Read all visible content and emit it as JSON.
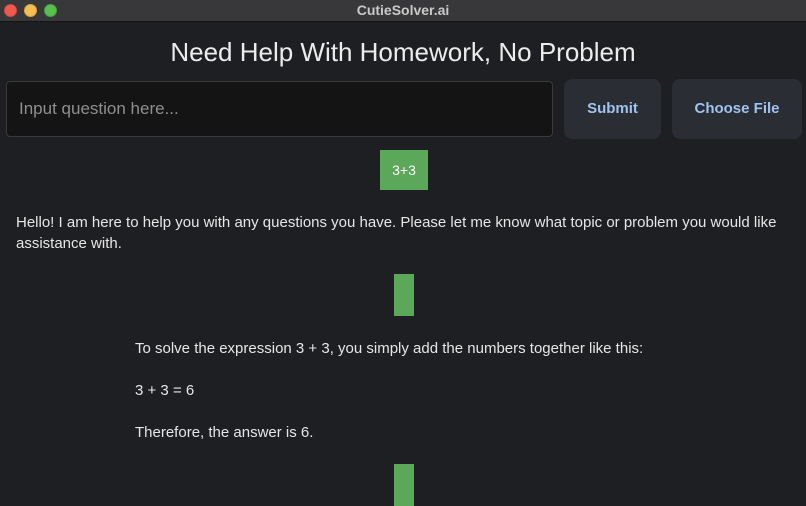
{
  "window": {
    "title": "CutieSolver.ai"
  },
  "header": {
    "title": "Need Help With Homework, No Problem"
  },
  "input": {
    "placeholder": "Input question here...",
    "value": ""
  },
  "buttons": {
    "submit_label": "Submit",
    "choose_file_label": "Choose File"
  },
  "conversation": {
    "user_messages": [
      "3+3",
      "",
      ""
    ],
    "assistant_messages": [
      {
        "paragraphs": [
          "Hello! I am here to help you with any questions you have. Please let me know what topic or problem you would like assistance with."
        ]
      },
      {
        "paragraphs": [
          "To solve the expression 3 + 3, you simply add the numbers together like this:",
          "3 + 3 = 6",
          "Therefore, the answer is 6."
        ]
      }
    ]
  },
  "colors": {
    "background": "#1e1f22",
    "user_bubble": "#5ba85a",
    "button_text": "#9fc3ee",
    "button_bg": "#2a2d33"
  }
}
